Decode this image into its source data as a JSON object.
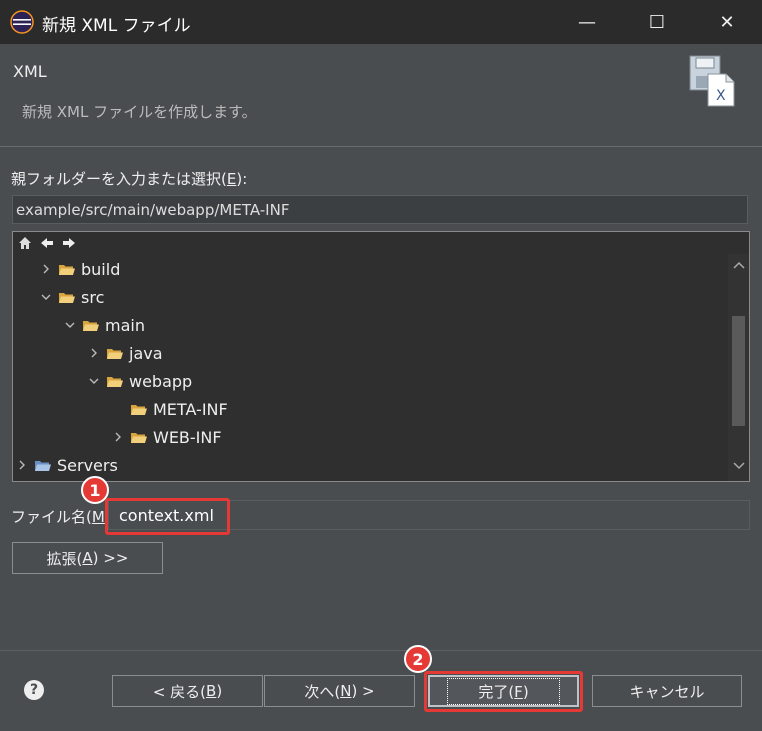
{
  "window": {
    "title": "新規 XML ファイル",
    "controls": {
      "minimize": "—",
      "maximize": "☐",
      "close": "✕"
    }
  },
  "header": {
    "title": "XML",
    "description": "新規 XML ファイルを作成します。"
  },
  "parent_folder": {
    "label_prefix": "親フォルダーを入力または選択(",
    "label_mnemonic": "E",
    "label_suffix": "):",
    "value": "example/src/main/webapp/META-INF"
  },
  "tree": {
    "items": [
      {
        "label": "build",
        "expanded": false,
        "type": "folder"
      },
      {
        "label": "src",
        "expanded": true,
        "type": "folder"
      },
      {
        "label": "main",
        "expanded": true,
        "type": "folder"
      },
      {
        "label": "java",
        "expanded": false,
        "type": "folder"
      },
      {
        "label": "webapp",
        "expanded": true,
        "type": "folder"
      },
      {
        "label": "META-INF",
        "expanded": null,
        "type": "folder"
      },
      {
        "label": "WEB-INF",
        "expanded": false,
        "type": "folder"
      },
      {
        "label": "Servers",
        "expanded": false,
        "type": "project"
      }
    ]
  },
  "file_name": {
    "label_prefix": "ファイル名(",
    "label_mnemonic": "M",
    "label_suffix": "):",
    "value": "context.xml"
  },
  "advanced_button": {
    "label_prefix": "拡張(",
    "label_mnemonic": "A",
    "label_suffix": ") >>"
  },
  "buttons": {
    "back": {
      "prefix": "< 戻る(",
      "mnemonic": "B",
      "suffix": ")"
    },
    "next": {
      "prefix": "次へ(",
      "mnemonic": "N",
      "suffix": ") >"
    },
    "finish": {
      "prefix": "完了(",
      "mnemonic": "F",
      "suffix": ")"
    },
    "cancel": {
      "label": "キャンセル"
    }
  },
  "annotations": {
    "badge_1": "1",
    "badge_2": "2"
  },
  "colors": {
    "highlight": "#e53935",
    "folder": "#e8c26a",
    "background": "#4a4d50"
  }
}
